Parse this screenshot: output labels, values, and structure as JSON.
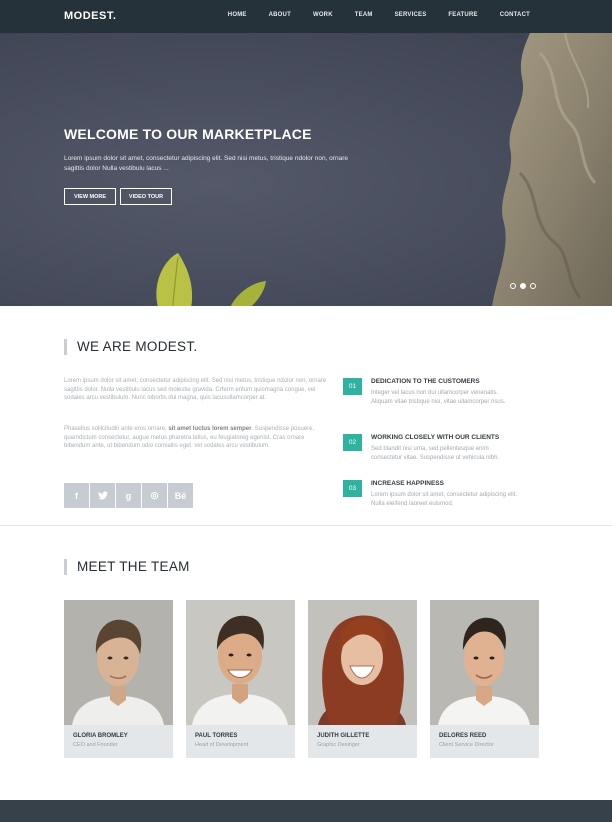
{
  "nav": {
    "logo": "MODEST.",
    "links": [
      "HOME",
      "ABOUT",
      "WORK",
      "TEAM",
      "SERVICES",
      "FEATURE",
      "CONTACT"
    ]
  },
  "hero": {
    "title": "WELCOME TO OUR MARKETPLACE",
    "text": "Lorem ipsum dolor sit amet, consectetur adipiscing elit. Sed nisi metus, tristique ndolor non, ornare sagittis dolor Nulla vestibulu lacus ...",
    "btn_more": "VIEW MORE",
    "btn_video": "VIDEO TOUR",
    "slides_total": 3,
    "active_slide": 2
  },
  "about": {
    "title": "WE ARE MODEST.",
    "p1": "Lorem ipsum dolor sit amet, consectetur adipiscing elit. Sed nisi metus, tristique ndolor non, ornare sagittis dolor. Nulla vestibulu lacus sed molestie gravida. Crferm entum quismagna congue, vel sodales arcu vestibulum. Nunc lobortis dui magna, quis lacusullamcorper at.",
    "p2_before": "Phasellus sollicitudin ante eros ornare, ",
    "p2_bold": "sit amet luctus lorem semper",
    "p2_after": ". Suspendisse posuere, quamdictum consectetur, augue metus pharetra tellus, eu feugiatoreg egenist. Cras ornare bibendum ante, ut bibendum odio convallis eget. vel sodales arcu vestibulum.",
    "social": [
      {
        "icon": "facebook-icon",
        "glyph": "f"
      },
      {
        "icon": "twitter-icon",
        "glyph": "t"
      },
      {
        "icon": "google-plus-icon",
        "glyph": "g"
      },
      {
        "icon": "dribbble-icon",
        "glyph": "◎"
      },
      {
        "icon": "behance-icon",
        "glyph": "Bē"
      }
    ],
    "features": [
      {
        "num": "01",
        "title": "DEDICATION TO THE CUSTOMERS",
        "text": "Integer vel lacus non dui ullamcorper venenatis. Aliquam vitae tristique nisi, vitae ullamcorper risus."
      },
      {
        "num": "02",
        "title": "WORKING CLOSELY WITH OUR CLIENTS",
        "text": "Sed blandit nisi urna, sed pellentesque enim consectetur vitae. Suspendisse ut vehicula nibh."
      },
      {
        "num": "03",
        "title": "INCREASE HAPPINESS",
        "text": "Lorem ipsum dolor sit amet, consectetur adipiscing elit. Nulla eleifend laoreet euismod."
      }
    ]
  },
  "team": {
    "title": "MEET THE TEAM",
    "members": [
      {
        "name": "GLORIA BROMLEY",
        "role": "CEO and Founder"
      },
      {
        "name": "PAUL TORRES",
        "role": "Head of Development"
      },
      {
        "name": "JUDITH GILLETTE",
        "role": "Graphic Desinger"
      },
      {
        "name": "DELORES REED",
        "role": "Client Service Director"
      }
    ]
  },
  "colors": {
    "nav_bg": "#26323a",
    "accent": "#2fb29f",
    "hero_bg": "#474c5c",
    "footer_bg": "#37414a"
  }
}
